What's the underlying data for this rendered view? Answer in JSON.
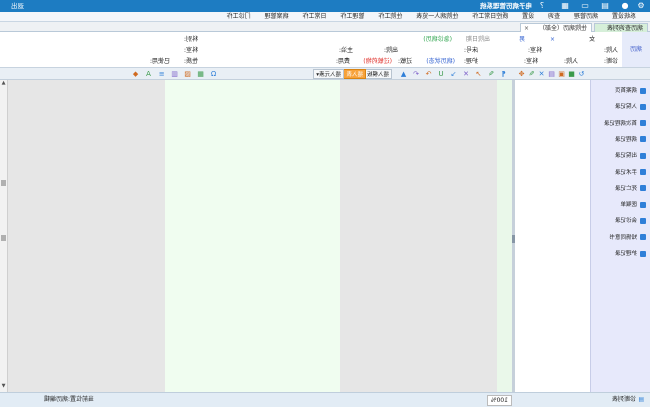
{
  "app": {
    "title": "电子病历管理系统",
    "logout": "退出"
  },
  "topbar_icons": [
    "gear-icon",
    "user-icon",
    "print-icon",
    "monitor-icon",
    "calendar-icon",
    "help-icon"
  ],
  "menu": [
    "系统设置",
    "病历管理",
    "查询",
    "设置",
    "质控日常工作",
    "住院病人一览表",
    "住院工作",
    "管理工作",
    "日常工作",
    "病案管理",
    "门诊工作"
  ],
  "tabs": [
    {
      "label": "病历查询列表"
    },
    {
      "label": "住院病历（全部）",
      "close": "×"
    }
  ],
  "patient": {
    "side_label": "病历",
    "female": "女",
    "clear": "×",
    "male": "男",
    "discharge_date": "出院日期",
    "record_type": "(急诊病历)",
    "dept_right": "科别:",
    "admit": "入院:",
    "dept": "科室:",
    "bed": "床号:",
    "discharge": "出院:",
    "doctor": "主治:",
    "ward": "科室:",
    "diagnosis": "诊断:",
    "admit2": "入院:",
    "dept2": "科室:",
    "nursing": "护理:",
    "record_status": "(病历状态)",
    "allergy": "过敏:",
    "allergy_drug": "(过敏药物)",
    "fee": "费用:",
    "nature": "性质:",
    "used": "已使用:"
  },
  "colors": {
    "top": "#1d7cc2",
    "green_text": "#2aa24a",
    "blue_text": "#2f5fd0",
    "red_text": "#e0302a",
    "orange": "#f7a23a"
  },
  "toolbar": {
    "panel_icons": [
      "refresh-icon",
      "save-icon",
      "save-all-icon",
      "print-icon",
      "delete-icon",
      "edit-icon",
      "move-icon"
    ],
    "edit_icons": [
      "format-icon",
      "pen-icon",
      "arrow-up-icon",
      "close-icon",
      "arrow-down-icon",
      "underline-icon",
      "redo-icon",
      "undo-icon",
      "brush-icon"
    ],
    "insert_template": "插入模板",
    "insert_table": "插入表",
    "insert_element": "插入元素▾",
    "right_icons": [
      "omega-icon",
      "table-icon",
      "image-icon",
      "grid-icon",
      "list-icon",
      "font-icon",
      "color-icon"
    ]
  },
  "record_list": [
    "病案首页",
    "入院记录",
    "首次病程记录",
    "病程记录",
    "出院记录",
    "手术记录",
    "死亡记录",
    "医嘱单",
    "会诊记录",
    "知情同意书",
    "护理记录"
  ],
  "status": {
    "left_icons": [
      "list-view-icon",
      "grid-view-icon"
    ],
    "diagnosis_list": "诊断列表",
    "zoom": "100%",
    "location": "当前位置:病历编辑"
  }
}
